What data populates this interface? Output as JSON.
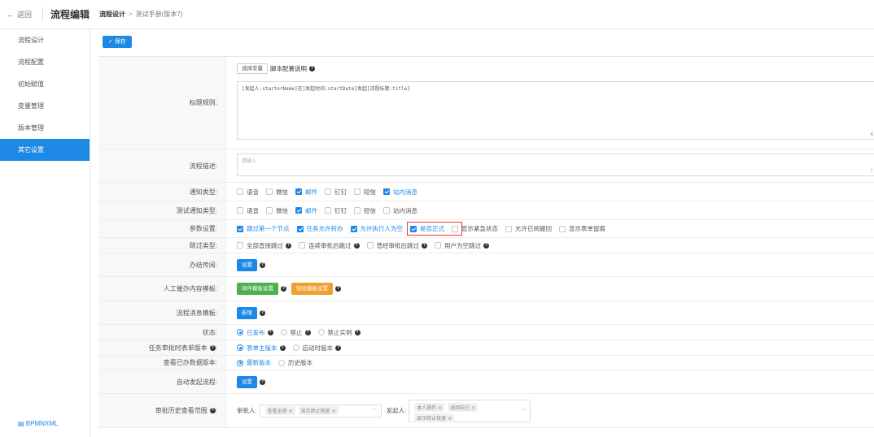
{
  "header": {
    "back_label": "返回",
    "app_title": "流程编辑",
    "breadcrumb_current": "流程设计",
    "breadcrumb_sep": ">",
    "breadcrumb_item": "测试手册(版本7)"
  },
  "sidebar": {
    "items": [
      {
        "label": "流程设计",
        "active": false
      },
      {
        "label": "流程配置",
        "active": false
      },
      {
        "label": "初始赋值",
        "active": false
      },
      {
        "label": "变量管理",
        "active": false
      },
      {
        "label": "版本管理",
        "active": false
      },
      {
        "label": "其它设置",
        "active": true
      }
    ],
    "footer": "BPMNXML"
  },
  "toolbar": {
    "save_label": "保存",
    "save_icon": "check-icon"
  },
  "title_rule": {
    "label": "标题规则:",
    "select_var_button": "选择变量",
    "script_help": "脚本配置说明",
    "value": "[发起人:startorName]在[发起时间:startDate]发起[流程标题:title]",
    "counter": "4"
  },
  "description": {
    "label": "流程描述:",
    "placeholder": "请输入",
    "counter": "("
  },
  "notify_type": {
    "label": "通知类型:",
    "options": [
      {
        "label": "语音",
        "checked": false
      },
      {
        "label": "微信",
        "checked": false
      },
      {
        "label": "邮件",
        "checked": true
      },
      {
        "label": "钉钉",
        "checked": false
      },
      {
        "label": "短信",
        "checked": false
      },
      {
        "label": "站内消息",
        "checked": true
      }
    ]
  },
  "test_notify_type": {
    "label": "测试通知类型:",
    "options": [
      {
        "label": "语音",
        "checked": false
      },
      {
        "label": "微信",
        "checked": false
      },
      {
        "label": "邮件",
        "checked": true
      },
      {
        "label": "钉钉",
        "checked": false
      },
      {
        "label": "短信",
        "checked": false
      },
      {
        "label": "站内消息",
        "checked": false
      }
    ]
  },
  "params": {
    "label": "参数设置:",
    "options": [
      {
        "label": "跳过第一个节点",
        "checked": true
      },
      {
        "label": "任务允许转办",
        "checked": true
      },
      {
        "label": "允许执行人为空",
        "checked": true
      },
      {
        "label": "是否正式",
        "checked": true
      },
      {
        "label": "显示紧急状态",
        "checked": false
      },
      {
        "label": "允许已阅撤回",
        "checked": false
      },
      {
        "label": "显示表单留痕",
        "checked": false
      }
    ]
  },
  "skip_type": {
    "label": "跳过类型:",
    "options": [
      {
        "label": "全部直接跳过",
        "checked": false
      },
      {
        "label": "连续审批后跳过",
        "checked": false
      },
      {
        "label": "曾经审批后跳过",
        "checked": false
      },
      {
        "label": "用户为空跳过",
        "checked": false
      }
    ]
  },
  "cc": {
    "label": "办结传阅:",
    "button": "设置"
  },
  "urge": {
    "label": "人工催办内容模板:",
    "mail_button": "邮件模板设置",
    "sms_button": "短信模板设置"
  },
  "msg_template": {
    "label": "流程消息模板:",
    "button": "新增"
  },
  "status": {
    "label": "状态:",
    "options": [
      {
        "label": "已发布",
        "checked": true
      },
      {
        "label": "禁止",
        "checked": false
      },
      {
        "label": "禁止实例",
        "checked": false
      }
    ]
  },
  "form_version": {
    "label": "任务审批时表单版本",
    "options": [
      {
        "label": "表单主版本",
        "checked": true
      },
      {
        "label": "启动时版本",
        "checked": false
      }
    ]
  },
  "done_version": {
    "label": "查看已办数据版本:",
    "options": [
      {
        "label": "最新版本",
        "checked": true
      },
      {
        "label": "历史版本",
        "checked": false
      }
    ]
  },
  "auto_start": {
    "label": "自动发起流程:",
    "button": "设置"
  },
  "history_scope": {
    "label": "审批历史查看范围",
    "approver_label": "审批人:",
    "approver_tags": [
      "查看全部",
      "显示终止恢复"
    ],
    "starter_label": "发起人:",
    "starter_tags": [
      "本人操作",
      "退回自己",
      "显示终止恢复"
    ]
  },
  "colors": {
    "accent": "#1e88e5",
    "green": "#4caf50",
    "orange": "#f0a030",
    "highlight": "#e53935"
  }
}
